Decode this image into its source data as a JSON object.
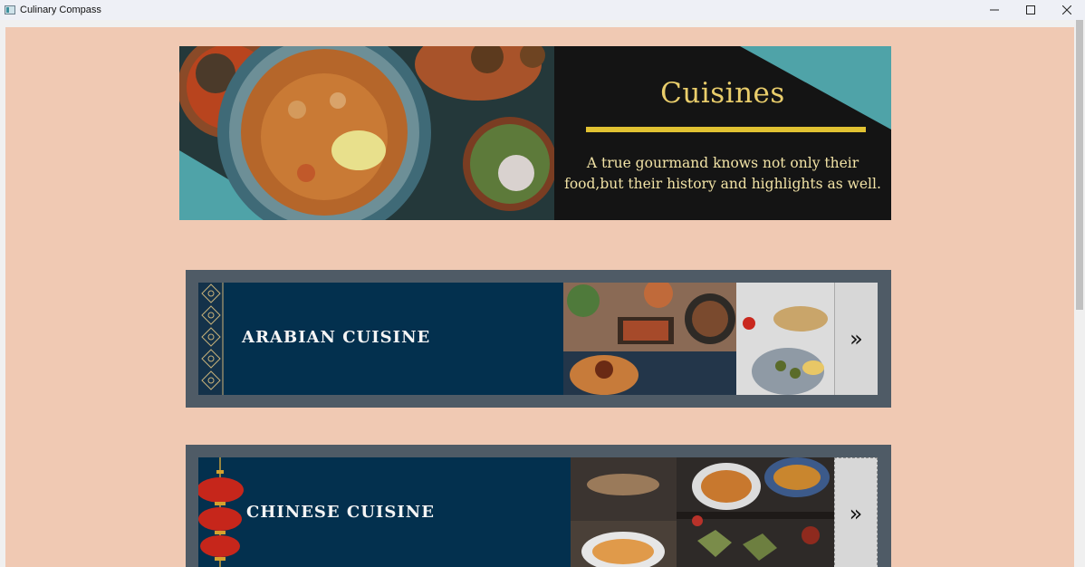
{
  "window": {
    "title": "Culinary Compass",
    "app_icon": "app-window-icon",
    "controls": {
      "minimize": "—",
      "maximize": "☐",
      "close": "✕"
    }
  },
  "hero": {
    "title": "Cuisines",
    "subtitle_line1": "A  true gourmand knows not only their",
    "subtitle_line2": "food,but their history and highlights as well.",
    "accent": "#e1c232",
    "teal": "#4fa3a8"
  },
  "cards": [
    {
      "label": "ARABIAN  CUISINE",
      "next_glyph": "»",
      "decor": "arabesque-border-icon"
    },
    {
      "label": "CHINESE  CUISINE",
      "next_glyph": "»",
      "decor": "lantern-icon"
    }
  ],
  "colors": {
    "background": "#f0c9b3",
    "card_frame": "#4f5b66",
    "card_panel": "#03304e"
  }
}
